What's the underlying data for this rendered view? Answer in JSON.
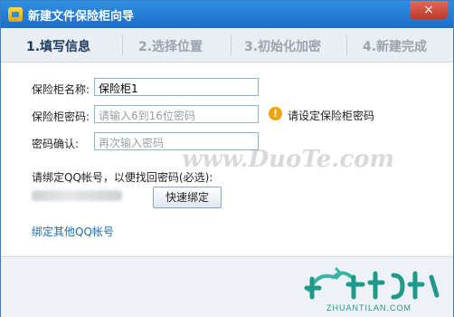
{
  "window": {
    "title": "新建文件保险柜向导",
    "close_symbol": "×"
  },
  "steps": [
    {
      "label": "1.填写信息"
    },
    {
      "label": "2.选择位置"
    },
    {
      "label": "3.初始化加密"
    },
    {
      "label": "4.新建完成"
    }
  ],
  "form": {
    "name_label": "保险柜名称:",
    "name_value": "保险柜1",
    "password_label": "保险柜密码:",
    "password_placeholder": "请输入6到16位密码",
    "confirm_label": "密码确认:",
    "confirm_placeholder": "再次输入密码",
    "warning_text": "请设定保险柜密码",
    "qq_prompt": "请绑定QQ帐号，以便找回密码(必选):",
    "bind_button": "快速绑定",
    "other_qq_link": "绑定其他QQ帐号"
  },
  "watermark": "www.DuoTe.com",
  "logo_caption": "ZHUANTILAN.COM",
  "colors": {
    "title_bar": "#1b6fc6",
    "link": "#1a6fb0",
    "warning": "#f1a300"
  }
}
